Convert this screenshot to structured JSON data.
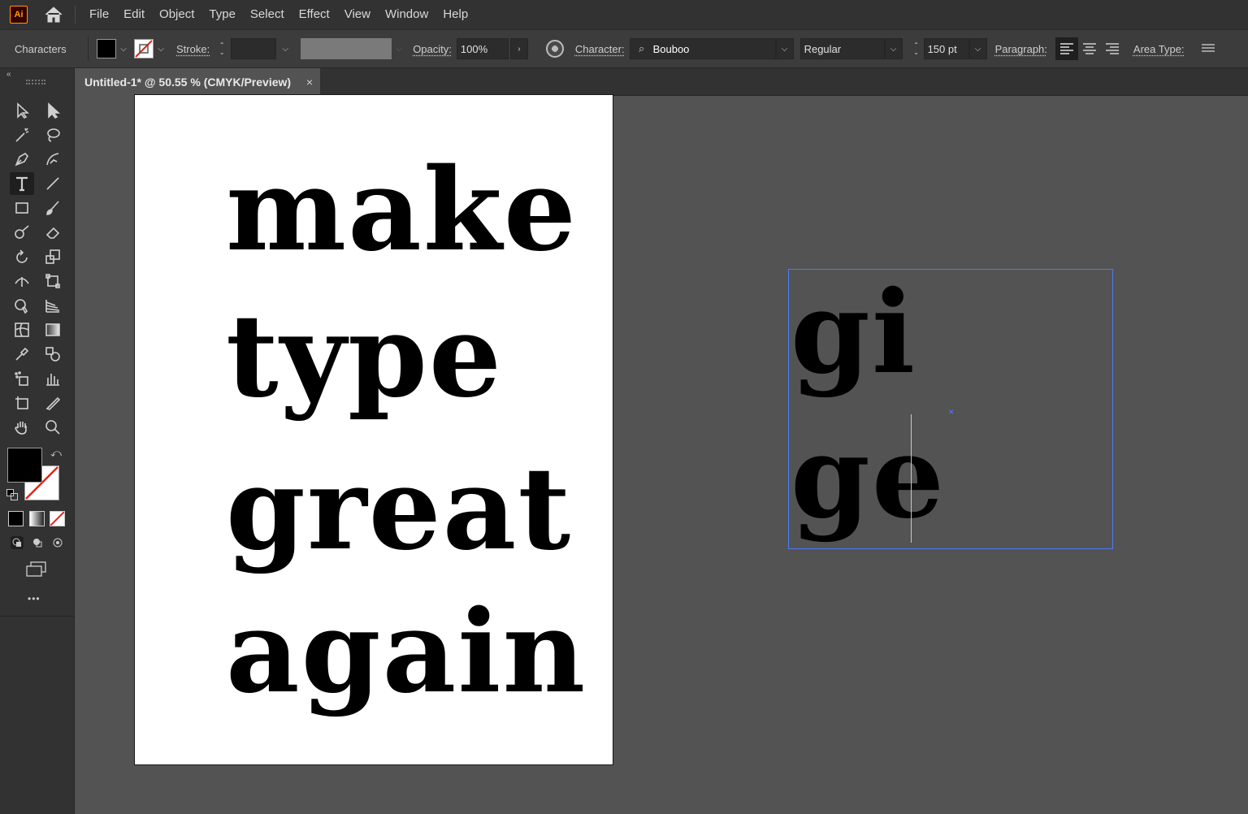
{
  "app": {
    "logo": "Ai"
  },
  "menu": [
    "File",
    "Edit",
    "Object",
    "Type",
    "Select",
    "Effect",
    "View",
    "Window",
    "Help"
  ],
  "control": {
    "panel_name": "Characters",
    "stroke_label": "Stroke:",
    "opacity_label": "Opacity:",
    "opacity_value": "100%",
    "character_label": "Character:",
    "font_family": "Bouboo",
    "font_style": "Regular",
    "font_size": "150 pt",
    "paragraph_label": "Paragraph:",
    "area_type_label": "Area Type:",
    "fill_color": "#000000"
  },
  "document": {
    "tab_title": "Untitled-1* @ 50.55 % (CMYK/Preview)",
    "close": "×"
  },
  "artboard": {
    "lines": [
      "make",
      "type",
      "great",
      "again"
    ]
  },
  "textframe": {
    "lines": [
      "gi",
      "ge"
    ]
  },
  "tools": {
    "more": "•••"
  }
}
